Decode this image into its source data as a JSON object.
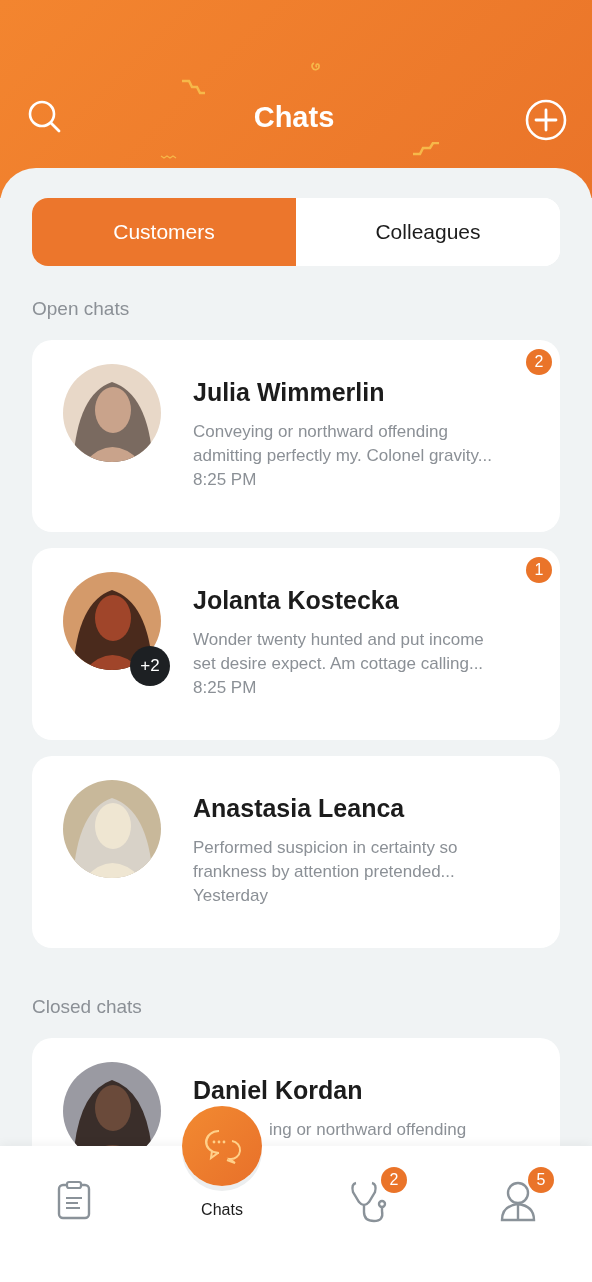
{
  "header": {
    "title": "Chats"
  },
  "tabs": [
    {
      "label": "Customers",
      "selected": true
    },
    {
      "label": "Colleagues",
      "selected": false
    }
  ],
  "sections": [
    {
      "title": "Open chats",
      "chats": [
        {
          "name": "Julia Wimmerlin",
          "preview": "Conveying or northward offending admitting perfectly my. Colonel gravity...",
          "time": "8:25 PM",
          "unread": "2"
        },
        {
          "name": "Jolanta Kostecka",
          "preview": "Wonder twenty hunted and put income set desire expect. Am cottage calling...",
          "time": "8:25 PM",
          "unread": "1",
          "extra": "+2"
        },
        {
          "name": "Anastasia Leanca",
          "preview": "Performed suspicion in certainty so frankness by attention pretended...",
          "time": "Yesterday"
        }
      ]
    },
    {
      "title": "Closed chats",
      "chats": [
        {
          "name": "Daniel Kordan",
          "preview": "ing or northward offending"
        }
      ]
    }
  ],
  "nav": [
    {
      "kind": "clipboard",
      "selected": false
    },
    {
      "kind": "chats",
      "label": "Chats",
      "selected": true
    },
    {
      "kind": "stethoscope",
      "badge": "2",
      "selected": false
    },
    {
      "kind": "person",
      "badge": "5",
      "selected": false
    }
  ]
}
